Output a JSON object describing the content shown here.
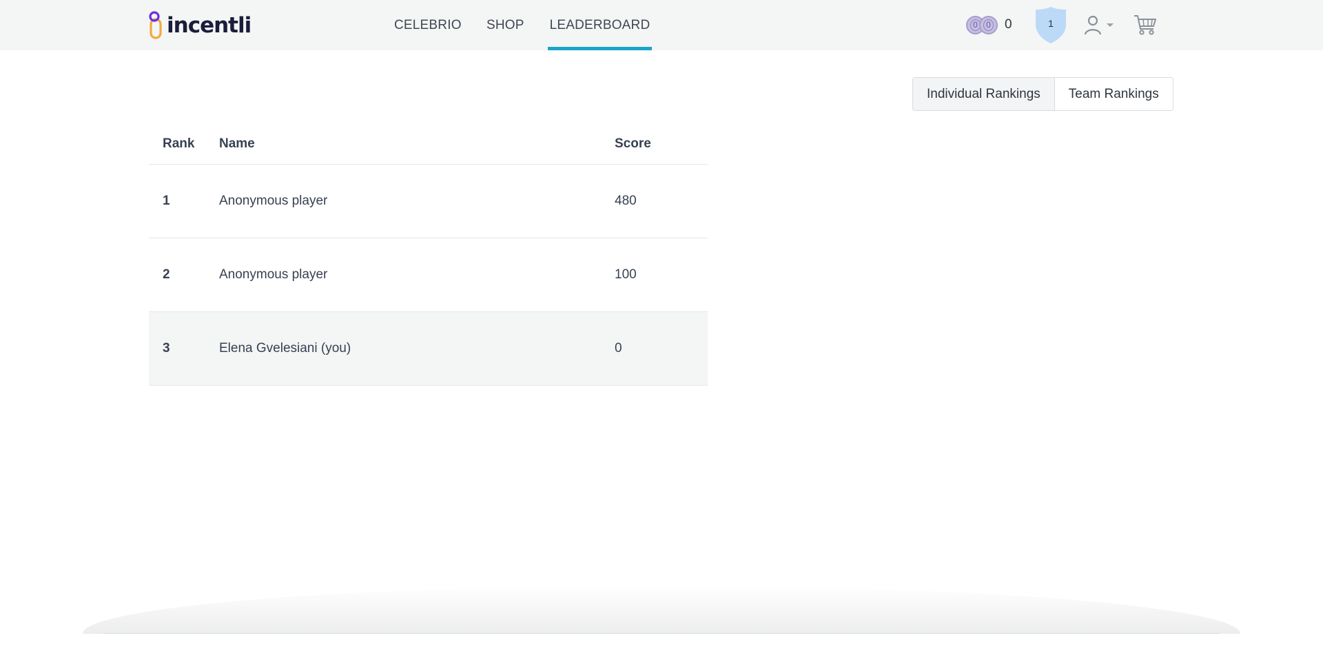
{
  "brand": {
    "name": "incentli",
    "colors": {
      "accent": "#1aa5c8",
      "logo_purple": "#6b2fe0",
      "logo_orange": "#f2a93b",
      "logo_text": "#1c1d3a"
    }
  },
  "nav": {
    "items": [
      {
        "label": "CELEBRIO",
        "active": false
      },
      {
        "label": "SHOP",
        "active": false
      },
      {
        "label": "LEADERBOARD",
        "active": true
      }
    ]
  },
  "header": {
    "coins": {
      "icon": "coins-icon",
      "coin_a": "0",
      "coin_b": "0",
      "count": "0"
    },
    "level": {
      "icon": "shield-icon",
      "value": "1"
    },
    "user": {
      "icon": "user-icon",
      "dropdown_icon": "caret-down-icon"
    },
    "cart": {
      "icon": "cart-icon"
    }
  },
  "rankings_toggle": {
    "individual_label": "Individual Rankings",
    "team_label": "Team Rankings",
    "selected": "Individual Rankings"
  },
  "leaderboard": {
    "columns": {
      "rank": "Rank",
      "name": "Name",
      "score": "Score"
    },
    "rows": [
      {
        "rank": "1",
        "name": "Anonymous player",
        "score": "480",
        "is_current_user": false
      },
      {
        "rank": "2",
        "name": "Anonymous player",
        "score": "100",
        "is_current_user": false
      },
      {
        "rank": "3",
        "name": "Elena Gvelesiani (you)",
        "score": "0",
        "is_current_user": true
      }
    ]
  }
}
